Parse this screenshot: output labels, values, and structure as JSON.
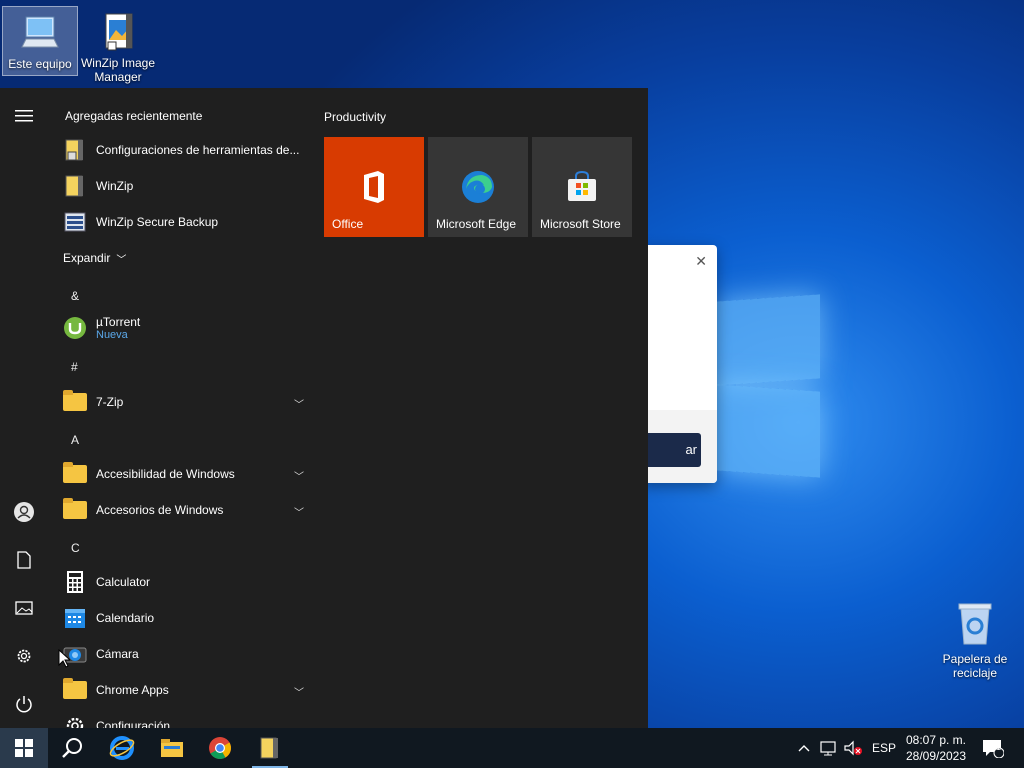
{
  "desktop": {
    "icons": [
      {
        "label": "Este equipo",
        "icon": "computer-icon"
      },
      {
        "label": "WinZip Image Manager",
        "icon": "winzip-image-manager-icon"
      },
      {
        "label": "Papelera de reciclaje",
        "icon": "recycle-bin-icon"
      }
    ]
  },
  "dialog": {
    "close": "✕",
    "button_label": "ar"
  },
  "start_menu": {
    "recent_title": "Agregadas recientemente",
    "recent": [
      {
        "label": "Configuraciones de herramientas de...",
        "icon": "winzip-tools-icon"
      },
      {
        "label": "WinZip",
        "icon": "winzip-icon"
      },
      {
        "label": "WinZip Secure Backup",
        "icon": "winzip-backup-icon"
      }
    ],
    "expand_label": "Expandir",
    "groups": [
      {
        "letter": "&"
      },
      {
        "letter": "#"
      },
      {
        "letter": "A"
      },
      {
        "letter": "C"
      }
    ],
    "apps": [
      {
        "label": "µTorrent",
        "sub": "Nueva",
        "icon": "utorrent-icon"
      },
      {
        "label": "7-Zip",
        "icon": "folder-icon"
      },
      {
        "label": "Accesibilidad de Windows",
        "icon": "folder-icon"
      },
      {
        "label": "Accesorios de Windows",
        "icon": "folder-icon"
      },
      {
        "label": "Calculator",
        "icon": "calculator-icon"
      },
      {
        "label": "Calendario",
        "icon": "calendar-icon"
      },
      {
        "label": "Cámara",
        "icon": "camera-icon"
      },
      {
        "label": "Chrome Apps",
        "icon": "folder-icon"
      },
      {
        "label": "Configuración",
        "icon": "gear-icon"
      }
    ],
    "tiles_title": "Productivity",
    "tiles": [
      {
        "label": "Office",
        "color": "#d83b01",
        "icon": "office-icon"
      },
      {
        "label": "Microsoft Edge",
        "color": "#363636",
        "icon": "edge-icon"
      },
      {
        "label": "Microsoft Store",
        "color": "#363636",
        "icon": "store-icon"
      }
    ],
    "rail": [
      "menu-icon",
      "user-icon",
      "document-icon",
      "pictures-icon",
      "gear-icon",
      "power-icon"
    ]
  },
  "taskbar": {
    "apps": [
      "windows-start-icon",
      "search-icon",
      "internet-explorer-icon",
      "file-explorer-icon",
      "chrome-icon",
      "winzip-icon"
    ],
    "tray": {
      "language": "ESP",
      "time": "08:07 p. m.",
      "date": "28/09/2023",
      "notifications": "1"
    }
  }
}
